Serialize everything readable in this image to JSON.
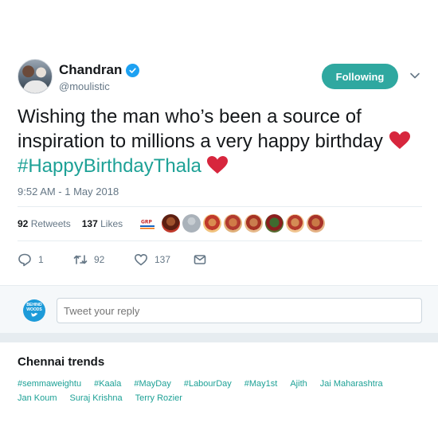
{
  "author": {
    "name": "Chandran",
    "handle": "@moulistic",
    "follow_label": "Following"
  },
  "tweet": {
    "text_line": "Wishing the man who’s been a source of inspiration to millions a very happy birthday",
    "hashtag": "#HappyBirthdayThala",
    "timestamp": "9:52 AM - 1 May 2018"
  },
  "stats": {
    "retweets_count": "92",
    "retweets_label": "Retweets",
    "likes_count": "137",
    "likes_label": "Likes"
  },
  "likers": [
    "liker-1",
    "liker-2",
    "liker-3",
    "liker-4",
    "liker-5",
    "liker-6",
    "liker-7",
    "liker-8"
  ],
  "actions": {
    "reply_count": "1",
    "retweet_count": "92",
    "like_count": "137"
  },
  "reply_box": {
    "logo_text": [
      "BEHIND",
      "WOODS"
    ],
    "placeholder": "Tweet your reply"
  },
  "trends": {
    "title": "Chennai trends",
    "items": [
      "#semmaweightu",
      "#Kaala",
      "#MayDay",
      "#LabourDay",
      "#May1st",
      "Ajith",
      "Jai Maharashtra",
      "Jan Koum",
      "Suraj Krishna",
      "Terry Rozier"
    ]
  },
  "colors": {
    "follow_button": "#2fa8a0",
    "hashtag": "#1da196",
    "verified": "#1da1f2",
    "heart": "#d7263d"
  }
}
